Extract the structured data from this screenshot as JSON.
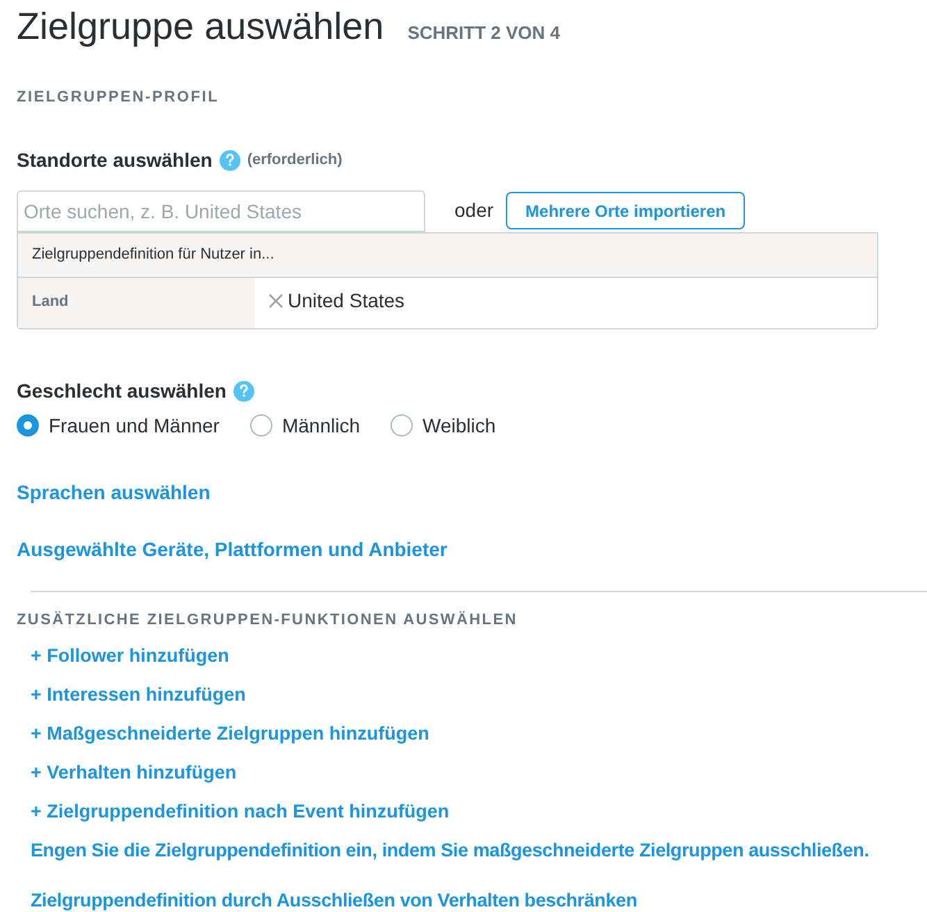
{
  "page": {
    "title": "Zielgruppe auswählen",
    "step": "SCHRITT 2 VON 4"
  },
  "profile": {
    "heading": "ZIELGRUPPEN-PROFIL",
    "location": {
      "label": "Standorte auswählen",
      "hint": "(erforderlich)",
      "search": {
        "placeholder": "Orte suchen, z. B. United States"
      },
      "or_text": "oder",
      "import_button": "Mehrere Orte importieren",
      "targeting": {
        "header": "Zielgruppendefinition für Nutzer in...",
        "rows": [
          {
            "label": "Land",
            "values": [
              "United States"
            ]
          }
        ]
      }
    },
    "gender": {
      "label": "Geschlecht auswählen",
      "options": [
        {
          "label": "Frauen und Männer",
          "selected": true
        },
        {
          "label": "Männlich",
          "selected": false
        },
        {
          "label": "Weiblich",
          "selected": false
        }
      ]
    },
    "links": [
      "Sprachen auswählen",
      "Ausgewählte Geräte, Plattformen und Anbieter"
    ]
  },
  "additional": {
    "heading": "ZUSÄTZLICHE ZIELGRUPPEN-FUNKTIONEN AUSWÄHLEN",
    "add_links": [
      "+ Follower hinzufügen",
      "+ Interessen hinzufügen",
      "+ Maßgeschneiderte Zielgruppen hinzufügen",
      "+ Verhalten hinzufügen",
      "+ Zielgruppendefinition nach Event hinzufügen"
    ],
    "exclusion_links": [
      "Engen Sie die Zielgruppendefinition ein, indem Sie maßgeschneiderte Zielgruppen ausschließen.",
      "Zielgruppendefinition durch Ausschließen von Verhalten beschränken"
    ]
  }
}
